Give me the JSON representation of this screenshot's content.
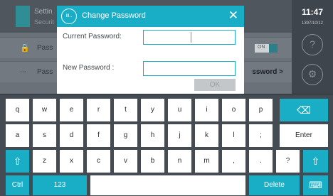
{
  "background": {
    "header_title": "Settin",
    "header_subtitle": "Securit",
    "row1_label": "Pass",
    "row1_toggle": "ON",
    "row2_label": "Pass",
    "row2_value": "ssword >"
  },
  "sidebar": {
    "time": "11:47",
    "date": "1397/10/12",
    "help_icon": "?",
    "gear_icon": "⚙"
  },
  "dialog": {
    "logo_text": "iii..",
    "title": "Change Password",
    "close_icon": "✕",
    "current_label": "Current Password:",
    "current_value": "",
    "new_label": "New Password :",
    "new_value": "",
    "ok_label": "OK"
  },
  "keyboard": {
    "row1": [
      "q",
      "w",
      "e",
      "r",
      "t",
      "y",
      "u",
      "i",
      "o",
      "p"
    ],
    "backspace_icon": "⌫",
    "row2": [
      "a",
      "s",
      "d",
      "f",
      "g",
      "h",
      "j",
      "k",
      "l",
      ";"
    ],
    "enter_label": "Enter",
    "shift_icon": "⇧",
    "row3": [
      "z",
      "x",
      "c",
      "v",
      "b",
      "n",
      "m",
      ",",
      ".",
      "?"
    ],
    "ctrl_label": "Ctrl",
    "num_label": "123",
    "space_label": "",
    "delete_label": "Delete",
    "hide_keyboard_icon": "⌨"
  },
  "colors": {
    "accent": "#1aaec6",
    "keyboard_bg": "#444b52"
  }
}
